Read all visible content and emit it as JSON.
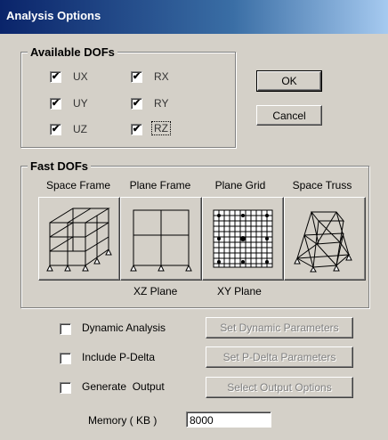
{
  "window": {
    "title": "Analysis Options"
  },
  "dofs": {
    "title": "Available DOFs",
    "items": [
      {
        "label": "UX",
        "checked": true
      },
      {
        "label": "UY",
        "checked": true
      },
      {
        "label": "UZ",
        "checked": true
      },
      {
        "label": "RX",
        "checked": true
      },
      {
        "label": "RY",
        "checked": true
      },
      {
        "label": "RZ",
        "checked": true
      }
    ]
  },
  "buttons": {
    "ok": "OK",
    "cancel": "Cancel"
  },
  "fast": {
    "title": "Fast DOFs",
    "options": [
      {
        "label": "Space Frame",
        "icon": "space-frame-icon"
      },
      {
        "label": "Plane Frame",
        "icon": "plane-frame-icon"
      },
      {
        "label": "Plane Grid",
        "icon": "plane-grid-icon"
      },
      {
        "label": "Space Truss",
        "icon": "space-truss-icon"
      }
    ],
    "xz": "XZ Plane",
    "xy": "XY Plane"
  },
  "options": [
    {
      "label": "Dynamic Analysis",
      "checked": false,
      "button": "Set Dynamic Parameters"
    },
    {
      "label": "Include P-Delta",
      "checked": false,
      "button": "Set P-Delta Parameters"
    },
    {
      "label": "Generate  Output",
      "checked": false,
      "button": "Select Output Options"
    }
  ],
  "memory": {
    "label": "Memory ( KB )",
    "value": "8000"
  },
  "check_glyph": "✔"
}
